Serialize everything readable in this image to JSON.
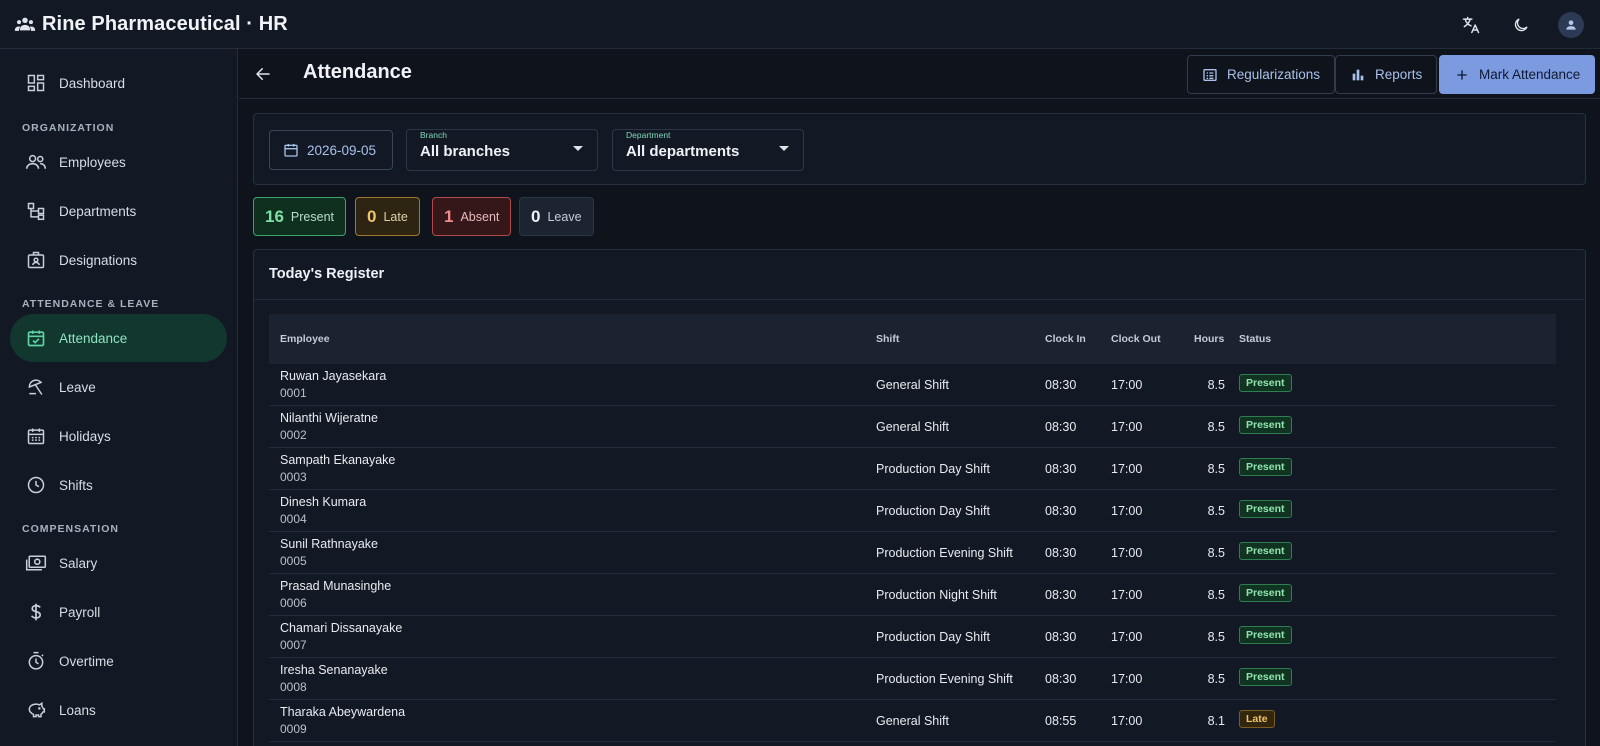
{
  "app": {
    "title": "Rine Pharmaceutical · HR"
  },
  "sidebar": {
    "items": [
      {
        "label": "Dashboard",
        "icon": "dashboard-icon"
      },
      {
        "label": "Employees",
        "icon": "people-icon"
      },
      {
        "label": "Departments",
        "icon": "hierarchy-icon"
      },
      {
        "label": "Designations",
        "icon": "badge-icon"
      },
      {
        "label": "Attendance",
        "icon": "calendar-check-icon",
        "active": true
      },
      {
        "label": "Leave",
        "icon": "leave-icon"
      },
      {
        "label": "Holidays",
        "icon": "calendar-icon"
      },
      {
        "label": "Shifts",
        "icon": "clock-icon"
      },
      {
        "label": "Salary",
        "icon": "money-icon"
      },
      {
        "label": "Payroll",
        "icon": "dollar-icon"
      },
      {
        "label": "Overtime",
        "icon": "timer-icon"
      },
      {
        "label": "Loans",
        "icon": "piggy-bank-icon"
      }
    ],
    "sections": {
      "organization": "ORGANIZATION",
      "attendance_leave": "ATTENDANCE & LEAVE",
      "compensation": "COMPENSATION"
    }
  },
  "header": {
    "title": "Attendance",
    "regularizations_label": "Regularizations",
    "reports_label": "Reports",
    "mark_attendance_label": "Mark Attendance"
  },
  "filters": {
    "date": "2026-09-05",
    "branch": {
      "label": "Branch",
      "value": "All branches"
    },
    "department": {
      "label": "Department",
      "value": "All departments"
    }
  },
  "stats": {
    "present": {
      "count": "16",
      "label": "Present"
    },
    "late": {
      "count": "0",
      "label": "Late"
    },
    "absent": {
      "count": "1",
      "label": "Absent"
    },
    "leave": {
      "count": "0",
      "label": "Leave"
    }
  },
  "register": {
    "title": "Today's Register",
    "columns": {
      "employee": "Employee",
      "shift": "Shift",
      "clock_in": "Clock In",
      "clock_out": "Clock Out",
      "hours": "Hours",
      "status": "Status"
    },
    "rows": [
      {
        "name": "Ruwan Jayasekara",
        "code": "0001",
        "shift": "General Shift",
        "clock_in": "08:30",
        "clock_out": "17:00",
        "hours": "8.5",
        "status": "Present"
      },
      {
        "name": "Nilanthi Wijeratne",
        "code": "0002",
        "shift": "General Shift",
        "clock_in": "08:30",
        "clock_out": "17:00",
        "hours": "8.5",
        "status": "Present"
      },
      {
        "name": "Sampath Ekanayake",
        "code": "0003",
        "shift": "Production Day Shift",
        "clock_in": "08:30",
        "clock_out": "17:00",
        "hours": "8.5",
        "status": "Present"
      },
      {
        "name": "Dinesh Kumara",
        "code": "0004",
        "shift": "Production Day Shift",
        "clock_in": "08:30",
        "clock_out": "17:00",
        "hours": "8.5",
        "status": "Present"
      },
      {
        "name": "Sunil Rathnayake",
        "code": "0005",
        "shift": "Production Evening Shift",
        "clock_in": "08:30",
        "clock_out": "17:00",
        "hours": "8.5",
        "status": "Present"
      },
      {
        "name": "Prasad Munasinghe",
        "code": "0006",
        "shift": "Production Night Shift",
        "clock_in": "08:30",
        "clock_out": "17:00",
        "hours": "8.5",
        "status": "Present"
      },
      {
        "name": "Chamari Dissanayake",
        "code": "0007",
        "shift": "Production Day Shift",
        "clock_in": "08:30",
        "clock_out": "17:00",
        "hours": "8.5",
        "status": "Present"
      },
      {
        "name": "Iresha Senanayake",
        "code": "0008",
        "shift": "Production Evening Shift",
        "clock_in": "08:30",
        "clock_out": "17:00",
        "hours": "8.5",
        "status": "Present"
      },
      {
        "name": "Tharaka Abeywardena",
        "code": "0009",
        "shift": "General Shift",
        "clock_in": "08:55",
        "clock_out": "17:00",
        "hours": "8.1",
        "status": "Late"
      }
    ]
  },
  "colors": {
    "accent": "#7b9ae0",
    "active_nav_bg": "#12372f",
    "present": "#3aa46a",
    "late": "#a07a2c",
    "absent": "#b14a4c"
  }
}
